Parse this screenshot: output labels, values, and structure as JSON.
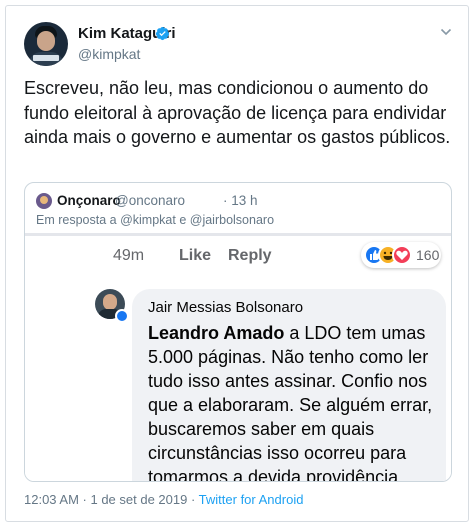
{
  "author": {
    "name": "Kim Kataguiri",
    "handle": "@kimpkat"
  },
  "tweet": {
    "text": "Escreveu, não leu, mas condicionou o aumento do fundo eleitoral à aprovação de licença para endividar ainda mais o governo e aumentar os gastos públicos."
  },
  "quoted": {
    "name": "Onçonaro",
    "handle": "@onconaro",
    "time": "· 13 h",
    "reply_prefix": "Em resposta a",
    "reply_to_1": "@kimpkat",
    "reply_and": "e",
    "reply_to_2": "@jairbolsonaro",
    "screenshot": {
      "time": "49m",
      "like_label": "Like",
      "reply_label": "Reply",
      "reaction_count": "160",
      "reactions": [
        "like",
        "haha",
        "love"
      ],
      "comment": {
        "author": "Jair Messias Bolsonaro",
        "mention": "Leandro Amado",
        "text": " a LDO tem umas 5.000 páginas. Não tenho como ler tudo isso antes assinar. Confio nos que a elaboraram. Se alguém errar, buscaremos saber em quais circunstâncias isso ocorreu para tomarmos a devida providência."
      }
    }
  },
  "footer": {
    "timestamp": "12:03 AM · 1 de set de 2019 ·",
    "source": "Twitter for Android"
  },
  "colors": {
    "verified": "#1da1f2",
    "text": "#14171a",
    "muted": "#657786",
    "facebook_blue": "#1877f2"
  },
  "icons": [
    "verified-badge-icon",
    "chevron-down-icon",
    "like-reaction-icon",
    "haha-reaction-icon",
    "love-reaction-icon"
  ]
}
